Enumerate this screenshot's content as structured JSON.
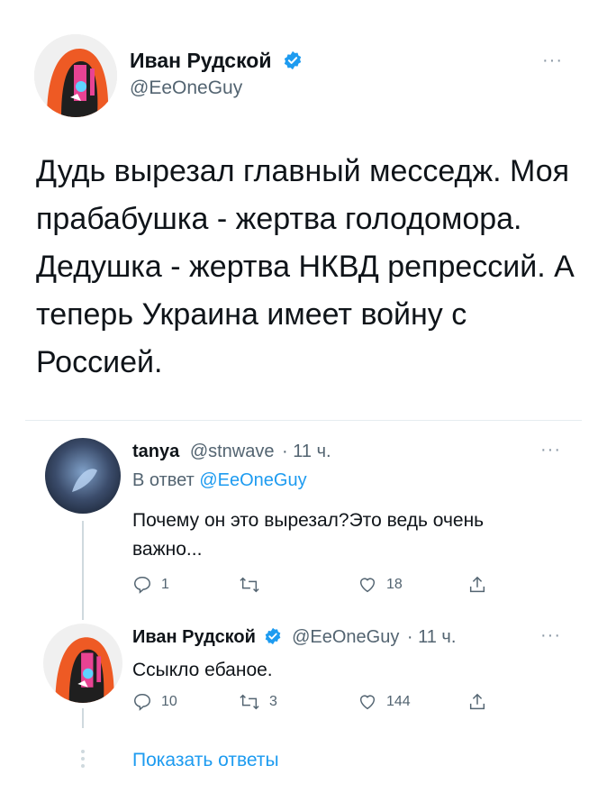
{
  "main_tweet": {
    "name": "Иван Рудской",
    "handle": "@EeOneGuy",
    "text": "Дудь вырезал главный месседж. Моя прабабушка - жертва голодомора. Дедушка - жертва НКВД репрессий. А теперь Украина имеет войну с Россией.",
    "more_icon": "more-icon",
    "verified_icon": "verified-icon"
  },
  "reply_1": {
    "name": "tanya",
    "handle": "@stnwave",
    "time": "· 11 ч.",
    "reply_to_prefix": "В ответ",
    "reply_to_handle": "@EeOneGuy",
    "text": "Почему он это вырезал?Это ведь очень важно...",
    "counts": {
      "replies": "1",
      "retweets": "",
      "likes": "18"
    }
  },
  "reply_2": {
    "name": "Иван Рудской",
    "handle": "@EeOneGuy",
    "time": "· 11 ч.",
    "text": "Ссыкло ебаное.",
    "counts": {
      "replies": "10",
      "retweets": "3",
      "likes": "144"
    }
  },
  "show_replies": "Показать ответы",
  "colors": {
    "accent": "#1d9bf0",
    "text": "#0f1419",
    "muted": "#536471",
    "line": "#cfd9de"
  }
}
